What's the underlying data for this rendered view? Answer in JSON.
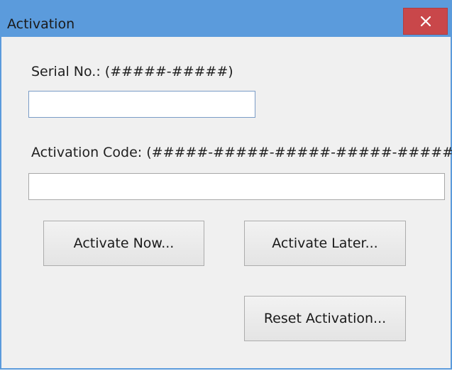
{
  "window": {
    "title": "Activation",
    "close_glyph": "✕",
    "titlebar_color": "#5b9bdc",
    "close_color": "#c9474a"
  },
  "serial": {
    "label": "Serial No.: (#####-#####)",
    "value": "",
    "placeholder": ""
  },
  "activation_code": {
    "label": "Activation Code: (#####-#####-#####-#####-#####)",
    "value": "",
    "placeholder": ""
  },
  "buttons": {
    "activate_now": "Activate Now...",
    "activate_later": "Activate Later...",
    "reset_activation": "Reset Activation..."
  }
}
